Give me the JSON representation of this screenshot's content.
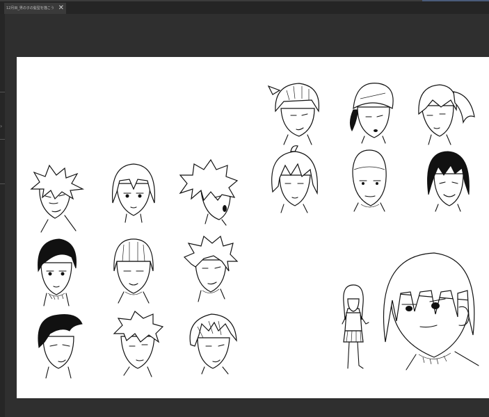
{
  "tab": {
    "title": "12月目_男の子の髪型を描こう",
    "close_glyph": "✕"
  },
  "colors": {
    "app_background": "#2f2f2f",
    "tab_bar": "#252525",
    "active_tab": "#3a3a3a",
    "canvas": "#ffffff",
    "ink": "#111111"
  },
  "canvas": {
    "description_items": [
      "spiky-hair-head",
      "bob-hair-head",
      "messy-hair-head-side",
      "slick-dark-hair-head",
      "bowl-cut-head",
      "wavy-hair-head",
      "pompadour-head",
      "swept-hair-head",
      "layered-hair-head",
      "bandana-head",
      "cap-head",
      "ponytail-head",
      "long-bangs-head",
      "buzz-cut-head",
      "dark-hair-smiling-head",
      "full-body-girl",
      "large-bob-head"
    ]
  }
}
